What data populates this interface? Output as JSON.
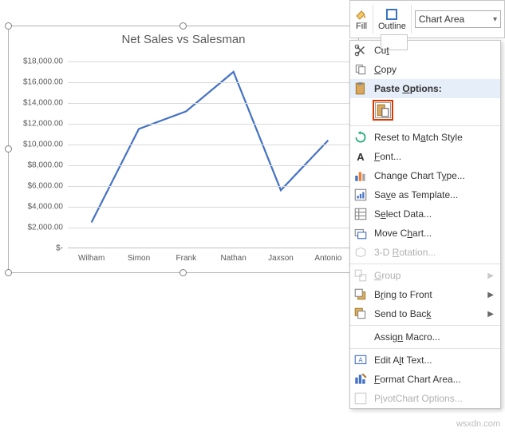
{
  "toolbar": {
    "fill_label": "Fill",
    "outline_label": "Outline",
    "chart_element_label": "Chart Area"
  },
  "chart_data": {
    "type": "line",
    "title": "Net Sales vs Salesman",
    "categories": [
      "Wilham",
      "Simon",
      "Frank",
      "Nathan",
      "Jaxson",
      "Antonio"
    ],
    "values": [
      2500,
      11500,
      13200,
      17000,
      5600,
      10400
    ],
    "y_ticks": [
      "$18,000.00",
      "$16,000.00",
      "$14,000.00",
      "$12,000.00",
      "$10,000.00",
      "$8,000.00",
      "$6,000.00",
      "$4,000.00",
      "$2,000.00",
      "$-"
    ],
    "ylim": [
      0,
      18000
    ],
    "xlabel": "",
    "ylabel": ""
  },
  "context_menu": {
    "cut": "Cut",
    "copy": "Copy",
    "paste_options_header": "Paste Options:",
    "reset": "Reset to Match Style",
    "font": "Font...",
    "change_type": "Change Chart Type...",
    "save_template": "Save as Template...",
    "select_data": "Select Data...",
    "move_chart": "Move Chart...",
    "rotation_3d": "3-D Rotation...",
    "group": "Group",
    "bring_front": "Bring to Front",
    "send_back": "Send to Back",
    "assign_macro": "Assign Macro...",
    "edit_alt": "Edit Alt Text...",
    "format_area": "Format Chart Area...",
    "pivotchart_options": "PivotChart Options..."
  },
  "watermark": "wsxdn.com"
}
